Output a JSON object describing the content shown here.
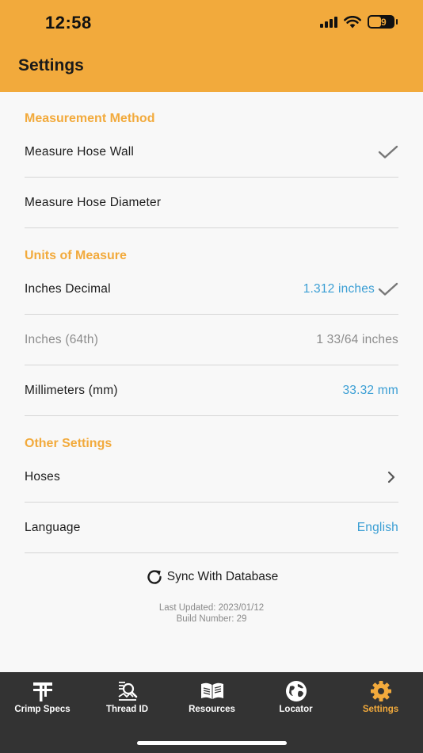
{
  "status_bar": {
    "time": "12:58",
    "battery": "49"
  },
  "header": {
    "title": "Settings"
  },
  "sections": {
    "measurement": {
      "title": "Measurement Method",
      "rows": [
        {
          "label": "Measure Hose Wall",
          "selected": true
        },
        {
          "label": "Measure Hose Diameter",
          "selected": false
        }
      ]
    },
    "units": {
      "title": "Units of Measure",
      "rows": [
        {
          "label": "Inches Decimal",
          "value": "1.312 inches",
          "selected": true
        },
        {
          "label": "Inches (64th)",
          "value": "1 33/64 inches",
          "disabled": true
        },
        {
          "label": "Millimeters (mm)",
          "value": "33.32 mm"
        }
      ]
    },
    "other": {
      "title": "Other Settings",
      "rows": [
        {
          "label": "Hoses"
        },
        {
          "label": "Language",
          "value": "English"
        }
      ]
    }
  },
  "sync": {
    "label": "Sync With Database"
  },
  "info": {
    "last_updated": "Last Updated: 2023/01/12",
    "build_number": "Build Number: 29"
  },
  "tabs": [
    {
      "label": "Crimp Specs",
      "icon": "crimp-specs-icon"
    },
    {
      "label": "Thread ID",
      "icon": "thread-id-icon"
    },
    {
      "label": "Resources",
      "icon": "book-icon"
    },
    {
      "label": "Locator",
      "icon": "globe-icon"
    },
    {
      "label": "Settings",
      "icon": "gear-icon",
      "active": true
    }
  ],
  "colors": {
    "accent": "#f2aa3c",
    "link": "#3a9ed4",
    "tabbar": "#333333"
  }
}
